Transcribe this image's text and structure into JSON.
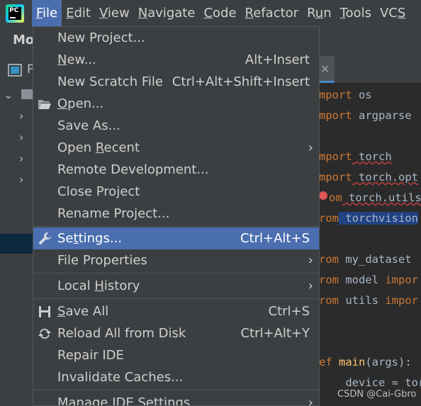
{
  "menubar": {
    "items": [
      {
        "pre": "",
        "mn": "F",
        "post": "ile"
      },
      {
        "pre": "",
        "mn": "E",
        "post": "dit"
      },
      {
        "pre": "",
        "mn": "V",
        "post": "iew"
      },
      {
        "pre": "",
        "mn": "N",
        "post": "avigate"
      },
      {
        "pre": "",
        "mn": "C",
        "post": "ode"
      },
      {
        "pre": "",
        "mn": "R",
        "post": "efactor"
      },
      {
        "pre": "R",
        "mn": "u",
        "post": "n"
      },
      {
        "pre": "",
        "mn": "T",
        "post": "ools"
      },
      {
        "pre": "VC",
        "mn": "S",
        "post": ""
      }
    ]
  },
  "background": {
    "project_title_partial": "Mo",
    "panel_letter": "P",
    "code_lines": [
      {
        "kw": "mport",
        "rest": " os"
      },
      {
        "kw": "mport",
        "rest": " argparse"
      },
      {
        "kw": "mport",
        "rest": " torch"
      },
      {
        "kw": "mport",
        "rest": " torch.opt"
      },
      {
        "kw": "om",
        "rest": " torch.utils"
      },
      {
        "kw": "rom",
        "rest": " torchvision"
      },
      {
        "kw": "rom",
        "rest": " my_dataset"
      },
      {
        "kw": "rom",
        "rest": " model ",
        "kw2": "impor"
      },
      {
        "kw": "rom",
        "rest": " utils ",
        "kw2": "impor"
      },
      {
        "kw": "ef",
        "fn": " main",
        "rest": "(args):"
      },
      {
        "rest": "    device = tor"
      }
    ],
    "watermark": "CSDN @Cai-Gbro"
  },
  "file_menu": {
    "items": [
      {
        "pre": "New Project...",
        "mn": "",
        "post": "",
        "shortcut": "",
        "submenu": false
      },
      {
        "pre": "",
        "mn": "N",
        "post": "ew...",
        "shortcut": "Alt+Insert",
        "submenu": false
      },
      {
        "pre": "New Scratch File",
        "mn": "",
        "post": "",
        "shortcut": "Ctrl+Alt+Shift+Insert",
        "submenu": false
      },
      {
        "pre": "",
        "mn": "O",
        "post": "pen...",
        "shortcut": "",
        "submenu": false,
        "icon": "folder-open-icon"
      },
      {
        "pre": "Save As...",
        "mn": "",
        "post": "",
        "shortcut": "",
        "submenu": false
      },
      {
        "pre": "Open ",
        "mn": "R",
        "post": "ecent",
        "shortcut": "",
        "submenu": true
      },
      {
        "pre": "Remote Development...",
        "mn": "",
        "post": "",
        "shortcut": "",
        "submenu": false
      },
      {
        "pre": "Close Pro",
        "mn": "j",
        "post": "ect",
        "shortcut": "",
        "submenu": false
      },
      {
        "pre": "Rename Project...",
        "mn": "",
        "post": "",
        "shortcut": "",
        "submenu": false
      },
      {
        "pre": "Se",
        "mn": "t",
        "post": "tings...",
        "shortcut": "Ctrl+Alt+S",
        "submenu": false,
        "icon": "wrench-icon",
        "selected": true
      },
      {
        "pre": "File Properties",
        "mn": "",
        "post": "",
        "shortcut": "",
        "submenu": true
      },
      {
        "pre": "Local ",
        "mn": "H",
        "post": "istory",
        "shortcut": "",
        "submenu": true
      },
      {
        "pre": "",
        "mn": "S",
        "post": "ave All",
        "shortcut": "Ctrl+S",
        "submenu": false,
        "icon": "save-icon"
      },
      {
        "pre": "Reload All from Disk",
        "mn": "",
        "post": "",
        "shortcut": "Ctrl+Alt+Y",
        "submenu": false,
        "icon": "reload-icon"
      },
      {
        "pre": "Repair IDE",
        "mn": "",
        "post": "",
        "shortcut": "",
        "submenu": false
      },
      {
        "pre": "Invalidate Caches...",
        "mn": "",
        "post": "",
        "shortcut": "",
        "submenu": false
      },
      {
        "pre": "Manage IDE Settings",
        "mn": "",
        "post": "",
        "shortcut": "",
        "submenu": true
      }
    ]
  }
}
